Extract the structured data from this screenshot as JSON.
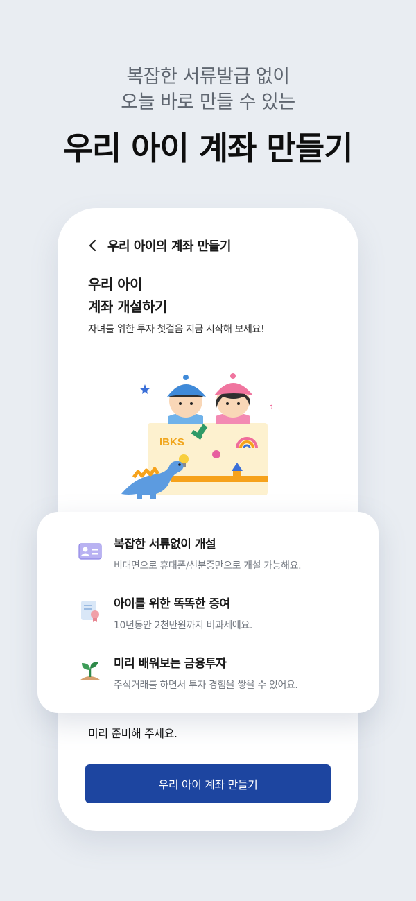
{
  "promo": {
    "subtitle_line1": "복잡한 서류발급 없이",
    "subtitle_line2": "오늘 바로 만들 수 있는",
    "title": "우리 아이 계좌 만들기"
  },
  "screen": {
    "nav_title": "우리 아이의 계좌 만들기",
    "hero_title_line1": "우리 아이",
    "hero_title_line2": "계좌 개설하기",
    "hero_desc": "자녀를 위한 투자 첫걸음 지금 시작해 보세요!",
    "board_label": "IBKS",
    "footnote": "미리 준비해 주세요.",
    "cta_label": "우리 아이 계좌 만들기"
  },
  "features": [
    {
      "icon": "id-card-icon",
      "title": "복잡한 서류없이 개설",
      "desc": "비대면으로 휴대폰/신분증만으로 개설 가능해요."
    },
    {
      "icon": "certificate-icon",
      "title": "아이를 위한 똑똑한 증여",
      "desc": "10년동안 2천만원까지 비과세에요."
    },
    {
      "icon": "sprout-icon",
      "title": "미리 배워보는 금융투자",
      "desc": "주식거래를 하면서 투자 경험을 쌓을 수 있어요."
    }
  ],
  "colors": {
    "background": "#e9edf2",
    "primary": "#1d45a0",
    "card": "#ffffff"
  }
}
